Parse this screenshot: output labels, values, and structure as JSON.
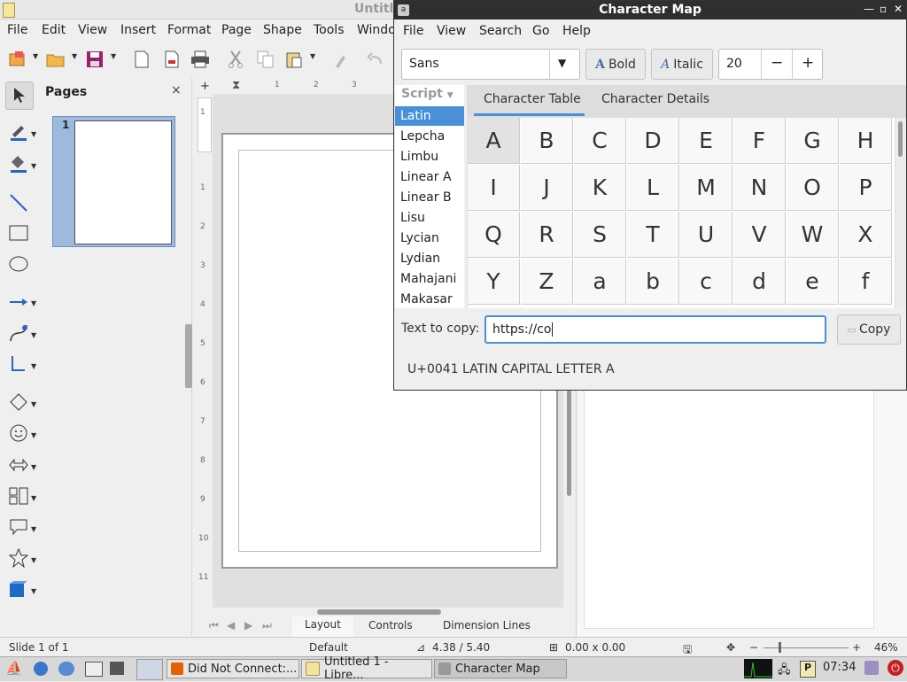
{
  "lo": {
    "title": "Untitl",
    "menu": [
      "File",
      "Edit",
      "View",
      "Insert",
      "Format",
      "Page",
      "Shape",
      "Tools",
      "Windo"
    ],
    "pages_panel": {
      "title": "Pages",
      "close": "×",
      "page_number": "1"
    },
    "bottom_tabs": [
      "Layout",
      "Controls",
      "Dimension Lines"
    ],
    "status": {
      "slide": "Slide 1 of 1",
      "layout": "Default",
      "position": "4.38 / 5.40",
      "size": "0.00 x 0.00",
      "zoom": "46%"
    },
    "ruler_h": [
      "1",
      "2",
      "3"
    ],
    "ruler_v": [
      "1",
      "1",
      "2",
      "3",
      "4",
      "5",
      "6",
      "7",
      "8",
      "9",
      "10",
      "11"
    ]
  },
  "charmap": {
    "title": "Character Map",
    "menu": [
      "File",
      "View",
      "Search",
      "Go",
      "Help"
    ],
    "font": "Sans",
    "bold_label": "Bold",
    "italic_label": "Italic",
    "size": "20",
    "minus": "−",
    "plus": "+",
    "script_header": "Script",
    "scripts": [
      "Latin",
      "Lepcha",
      "Limbu",
      "Linear A",
      "Linear B",
      "Lisu",
      "Lycian",
      "Lydian",
      "Mahajani",
      "Makasar"
    ],
    "tabs": [
      "Character Table",
      "Character Details"
    ],
    "chars": [
      "A",
      "B",
      "C",
      "D",
      "E",
      "F",
      "G",
      "H",
      "I",
      "J",
      "K",
      "L",
      "M",
      "N",
      "O",
      "P",
      "Q",
      "R",
      "S",
      "T",
      "U",
      "V",
      "W",
      "X",
      "Y",
      "Z",
      "a",
      "b",
      "c",
      "d",
      "e",
      "f"
    ],
    "copy_label": "Text to copy:",
    "copy_value": "https://co",
    "copy_button": "Copy",
    "char_description": "U+0041 LATIN CAPITAL LETTER A"
  },
  "taskbar": {
    "tasks": [
      "Did Not Connect:...",
      "Untitled 1 - Libre...",
      "Character Map"
    ],
    "clock": "07:34"
  },
  "colors": {
    "accent": "#4a90d9",
    "titlebar": "#2f2f2f"
  }
}
